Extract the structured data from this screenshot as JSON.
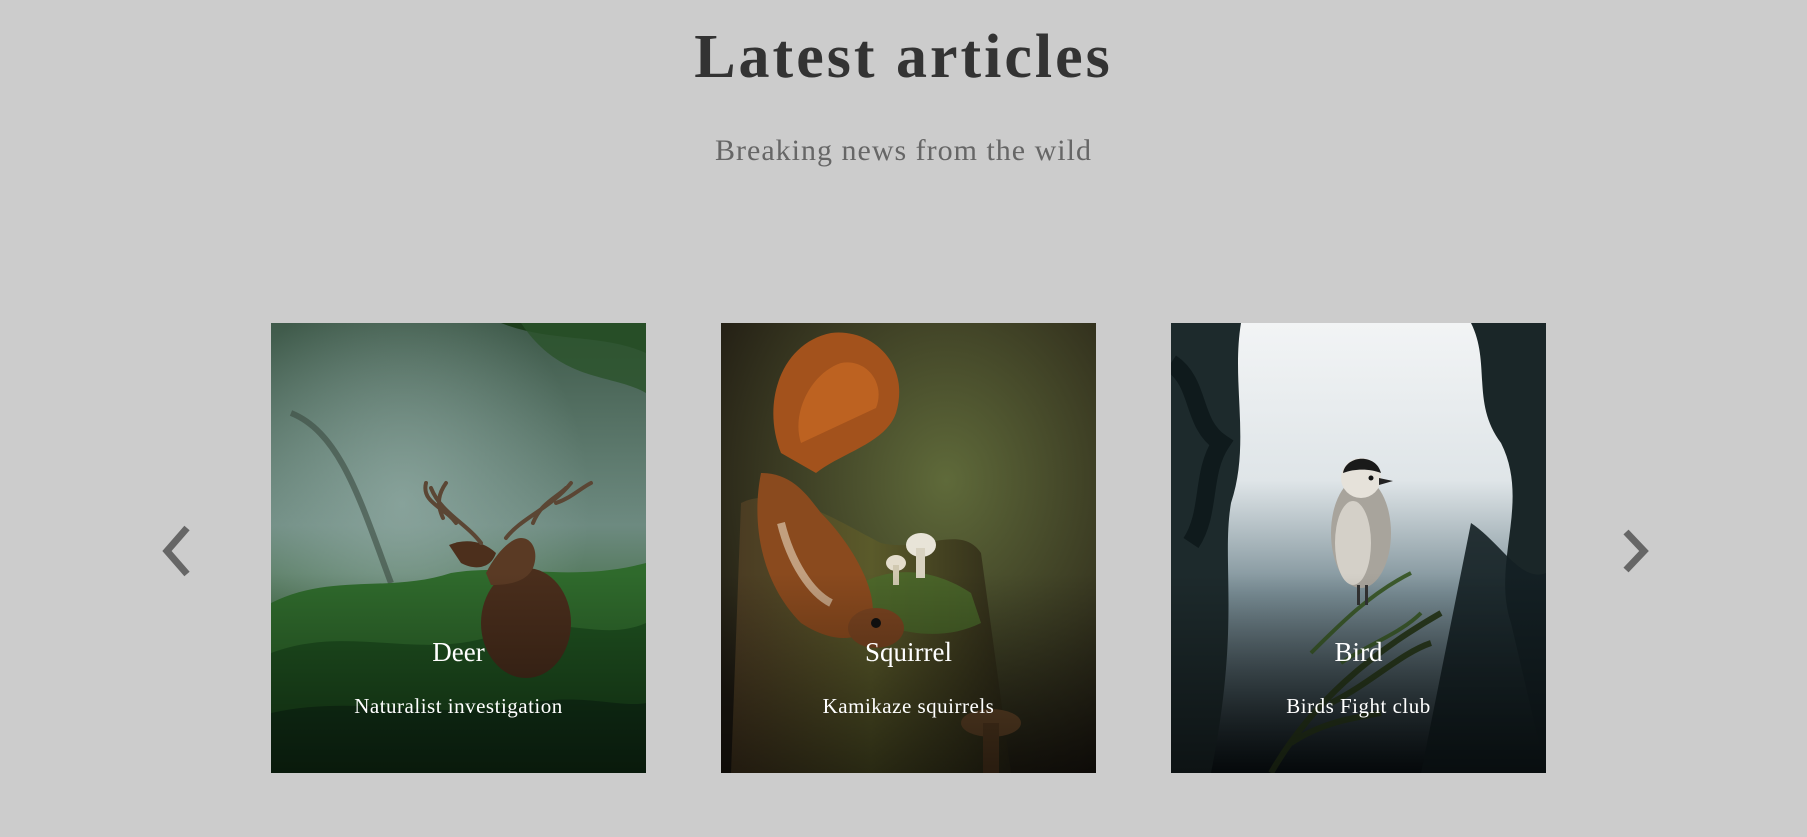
{
  "header": {
    "title": "Latest articles",
    "subtitle": "Breaking news from the wild"
  },
  "carousel": {
    "prev_icon": "chevron-left-icon",
    "next_icon": "chevron-right-icon",
    "arrow_color": "#666666",
    "cards": [
      {
        "title": "Deer",
        "caption": "Naturalist investigation",
        "image": "deer-in-forest-photo"
      },
      {
        "title": "Squirrel",
        "caption": "Kamikaze squirrels",
        "image": "squirrel-on-stump-photo"
      },
      {
        "title": "Bird",
        "caption": "Birds Fight club",
        "image": "bird-on-pine-branch-photo"
      }
    ]
  },
  "colors": {
    "background": "#cccccc",
    "title": "#333333",
    "subtitle": "#666666",
    "card_text": "#ffffff"
  }
}
